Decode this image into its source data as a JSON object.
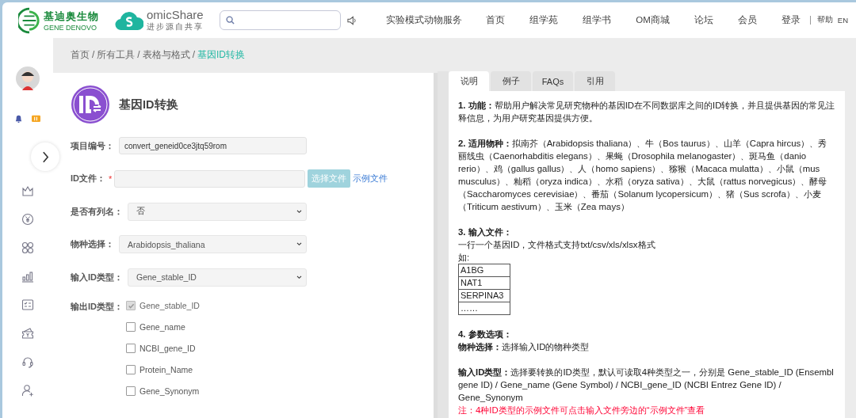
{
  "header": {
    "brand": {
      "name": "基迪奥生物",
      "sub": "GENE DENOVO"
    },
    "site": {
      "name": "omicShare",
      "slogan": "进步源自共享"
    },
    "nav": [
      {
        "label": "实验模式动物服务"
      },
      {
        "label": "首页"
      },
      {
        "label": "组学苑"
      },
      {
        "label": "组学书"
      },
      {
        "label": "OM商城"
      },
      {
        "label": "论坛"
      },
      {
        "label": "会员"
      },
      {
        "label": "登录"
      }
    ],
    "links": [
      {
        "label": "帮助"
      },
      {
        "label": "EN"
      }
    ]
  },
  "breadcrumb": {
    "separator": "/",
    "items": [
      {
        "label": "首页",
        "selected": false
      },
      {
        "label": "所有工具",
        "selected": false
      },
      {
        "label": "表格与格式",
        "selected": false
      },
      {
        "label": "基因ID转换",
        "selected": true
      }
    ]
  },
  "tool": {
    "title": "基因ID转换",
    "fields": [
      {
        "kind": "text",
        "label": "项目编号：",
        "value": "convert_geneid0ce3jtq59rom"
      },
      {
        "kind": "file",
        "label": "ID文件：",
        "required": "*",
        "button": "选择文件",
        "link": "示例文件"
      },
      {
        "kind": "select",
        "label": "是否有列名：",
        "value": "否"
      },
      {
        "kind": "select",
        "label": "物种选择：",
        "value": "Arabidopsis_thaliana"
      },
      {
        "kind": "select",
        "label": "输入ID类型：",
        "value": "Gene_stable_ID"
      }
    ],
    "output": {
      "label": "输出ID类型：",
      "options": [
        {
          "label": "Gene_stable_ID",
          "checked": true,
          "disabled": true
        },
        {
          "label": "Gene_name",
          "checked": false,
          "disabled": false
        },
        {
          "label": "NCBI_gene_ID",
          "checked": false,
          "disabled": false
        },
        {
          "label": "Protein_Name",
          "checked": false,
          "disabled": false
        },
        {
          "label": "Gene_Synonym",
          "checked": false,
          "disabled": false
        }
      ]
    }
  },
  "tabs": [
    {
      "label": "说明",
      "selected": true
    },
    {
      "label": "例子",
      "selected": false
    },
    {
      "label": "FAQs",
      "selected": false
    },
    {
      "label": "引用",
      "selected": false
    }
  ],
  "doc": [
    {
      "kind": "para",
      "text": "**1. 功能：**帮助用户解决常见研究物种的基因ID在不同数据库之间的ID转换，并且提供基因的常见注释信息，为用户研究基因提供方便。"
    },
    {
      "kind": "para",
      "text": "**2. 适用物种：**拟南芥（Arabidopsis thaliana）、牛（Bos taurus）、山羊（Capra hircus）、秀丽线虫（Caenorhabditis elegans）、果蝇（Drosophila melanogaster）、斑马鱼（danio rerio）、鸡（gallus gallus）、人（homo sapiens）、猕猴（Macaca mulatta）、小鼠（mus musculus）、籼稻（oryza indica）、水稻（oryza sativa）、大鼠（rattus norvegicus）、酵母（Saccharomyces cerevisiae）、番茄（Solanum lycopersicum）、猪（Sus scrofa）、小麦（Triticum aestivum）、玉米（Zea mays）"
    },
    {
      "kind": "heading",
      "text": "3. 输入文件："
    },
    {
      "kind": "line",
      "text": "一行一个基因ID，文件格式支持txt/csv/xls/xlsx格式"
    },
    {
      "kind": "line",
      "text": "如:"
    },
    {
      "kind": "table",
      "rows": [
        "A1BG",
        "NAT1",
        "SERPINA3",
        "……"
      ]
    },
    {
      "kind": "heading",
      "text": "4. 参数选项："
    },
    {
      "kind": "para",
      "text": "**物种选择：**选择输入ID的物种类型"
    },
    {
      "kind": "line",
      "text": "**输入ID类型：**选择要转换的ID类型，默认可读取4种类型之一，分别是 Gene_stable_ID (Ensembl gene ID) / Gene_name (Gene Symbol) / NCBI_gene_ID (NCBI Entrez Gene ID) / Gene_Synonym"
    },
    {
      "kind": "note",
      "text": "注：4种ID类型的示例文件可点击输入文件旁边的“示例文件”查看"
    }
  ]
}
